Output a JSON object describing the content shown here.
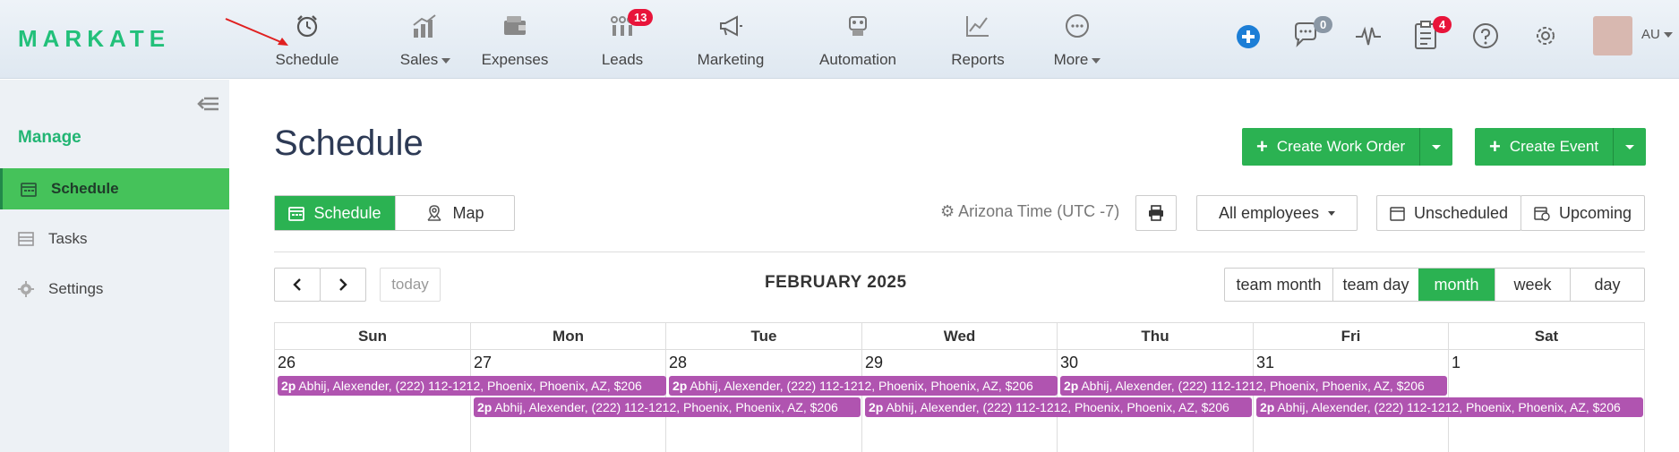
{
  "brand": {
    "logo": "MARKATE",
    "color": "#22c07a"
  },
  "nav": {
    "items": [
      {
        "label": "Schedule",
        "icon": "alarm-clock-icon"
      },
      {
        "label": "Sales",
        "icon": "bar-chart-icon"
      },
      {
        "label": "Expenses",
        "icon": "wallet-icon"
      },
      {
        "label": "Leads",
        "icon": "leads-icon",
        "badge": "13"
      },
      {
        "label": "Marketing",
        "icon": "megaphone-icon"
      },
      {
        "label": "Automation",
        "icon": "robot-icon"
      },
      {
        "label": "Reports",
        "icon": "line-chart-icon"
      },
      {
        "label": "More",
        "icon": "more-dots-icon"
      }
    ],
    "chat_badge": "0",
    "tasks_badge": "4",
    "user": "AU"
  },
  "sidebar": {
    "heading": "Manage",
    "items": [
      {
        "label": "Schedule",
        "icon": "calendar-icon",
        "active": true
      },
      {
        "label": "Tasks",
        "icon": "tasks-icon"
      },
      {
        "label": "Settings",
        "icon": "gear-icon"
      }
    ]
  },
  "page": {
    "title": "Schedule",
    "create_work_order": "Create Work Order",
    "create_event": "Create Event",
    "view_toggle": {
      "schedule": "Schedule",
      "map": "Map"
    },
    "timezone": "Arizona Time (UTC -7)",
    "employees": "All employees",
    "unscheduled": "Unscheduled",
    "upcoming": "Upcoming"
  },
  "calendar": {
    "today_label": "today",
    "month_label": "FEBRUARY 2025",
    "views": [
      "team month",
      "team day",
      "month",
      "week",
      "day"
    ],
    "active_view": "month",
    "days_of_week": [
      "Sun",
      "Mon",
      "Tue",
      "Wed",
      "Thu",
      "Fri",
      "Sat"
    ],
    "dates": [
      "26",
      "27",
      "28",
      "29",
      "30",
      "31",
      "1"
    ],
    "event_color": "#b054b0",
    "event_time": "2p",
    "event_text": "Abhij, Alexender, (222) 112-1212, Phoenix, Phoenix, AZ, $206"
  }
}
